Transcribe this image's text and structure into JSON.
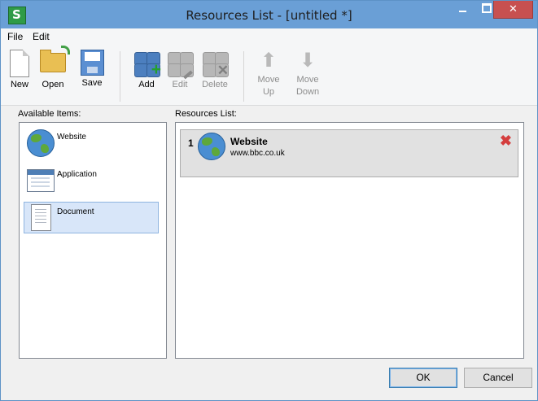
{
  "window": {
    "title": "Resources List - [untitled *]",
    "accent": "#6a9fd6"
  },
  "menu": [
    {
      "label": "File"
    },
    {
      "label": "Edit"
    }
  ],
  "toolbar": {
    "new": "New",
    "open": "Open",
    "save": "Save",
    "add": "Add",
    "edit": "Edit",
    "delete": "Delete",
    "move_up": "Move Up",
    "move_down": "Move Down"
  },
  "available": {
    "label": "Available Items:",
    "items": [
      {
        "label": "Website",
        "icon": "globe-icon"
      },
      {
        "label": "Application",
        "icon": "application-window-icon"
      },
      {
        "label": "Document",
        "icon": "document-icon",
        "selected": true
      }
    ]
  },
  "resources": {
    "label": "Resources List:",
    "items": [
      {
        "index": "1",
        "title": "Website",
        "url": "www.bbc.co.uk",
        "icon": "globe-icon"
      }
    ]
  },
  "buttons": {
    "ok": "OK",
    "cancel": "Cancel"
  }
}
